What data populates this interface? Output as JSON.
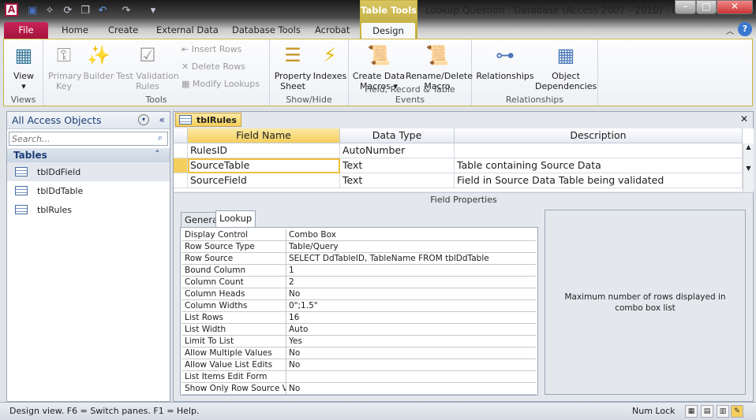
{
  "window": {
    "title": "Lookup Question : Database (Access 2007 - 2010)  -  Mi...",
    "context_tab_group": "Table Tools",
    "app_icon": "A"
  },
  "tabs": [
    "File",
    "Home",
    "Create",
    "External Data",
    "Database Tools",
    "Acrobat",
    "Design"
  ],
  "ribbon": {
    "views": {
      "label": "Views",
      "view": "View"
    },
    "tools": {
      "label": "Tools",
      "primary_key": "Primary Key",
      "builder": "Builder",
      "test_validation": "Test Validation Rules",
      "insert_rows": "Insert Rows",
      "delete_rows": "Delete Rows",
      "modify_lookups": "Modify Lookups"
    },
    "show_hide": {
      "label": "Show/Hide",
      "property_sheet": "Property Sheet",
      "indexes": "Indexes"
    },
    "events": {
      "label": "Field, Record & Table Events",
      "create_data_macros": "Create Data Macros",
      "rename_delete_macro": "Rename/Delete Macro"
    },
    "relationships": {
      "label": "Relationships",
      "relationships": "Relationships",
      "object_dependencies": "Object Dependencies"
    }
  },
  "nav": {
    "title": "All Access Objects",
    "search_placeholder": "Search...",
    "category": "Tables",
    "items": [
      "tblDdField",
      "tblDdTable",
      "tblRules"
    ]
  },
  "document": {
    "tab": "tblRules",
    "columns": [
      "Field Name",
      "Data Type",
      "Description"
    ],
    "rows": [
      [
        "RulesID",
        "AutoNumber",
        ""
      ],
      [
        "SourceTable",
        "Text",
        "Table containing Source Data"
      ],
      [
        "SourceField",
        "Text",
        "Field in Source Data Table being validated"
      ]
    ],
    "field_properties_label": "Field Properties",
    "prop_tabs": [
      "General",
      "Lookup"
    ],
    "properties": [
      [
        "Display Control",
        "Combo Box"
      ],
      [
        "Row Source Type",
        "Table/Query"
      ],
      [
        "Row Source",
        "SELECT DdTableID, TableName FROM tblDdTable"
      ],
      [
        "Bound Column",
        "1"
      ],
      [
        "Column Count",
        "2"
      ],
      [
        "Column Heads",
        "No"
      ],
      [
        "Column Widths",
        "0\";1.5\""
      ],
      [
        "List Rows",
        "16"
      ],
      [
        "List Width",
        "Auto"
      ],
      [
        "Limit To List",
        "Yes"
      ],
      [
        "Allow Multiple Values",
        "No"
      ],
      [
        "Allow Value List Edits",
        "No"
      ],
      [
        "List Items Edit Form",
        ""
      ],
      [
        "Show Only Row Source V",
        "No"
      ]
    ],
    "help_text": "Maximum number of rows displayed in combo box list"
  },
  "status": {
    "left": "Design view.  F6 = Switch panes.  F1 = Help.",
    "num_lock": "Num Lock"
  }
}
